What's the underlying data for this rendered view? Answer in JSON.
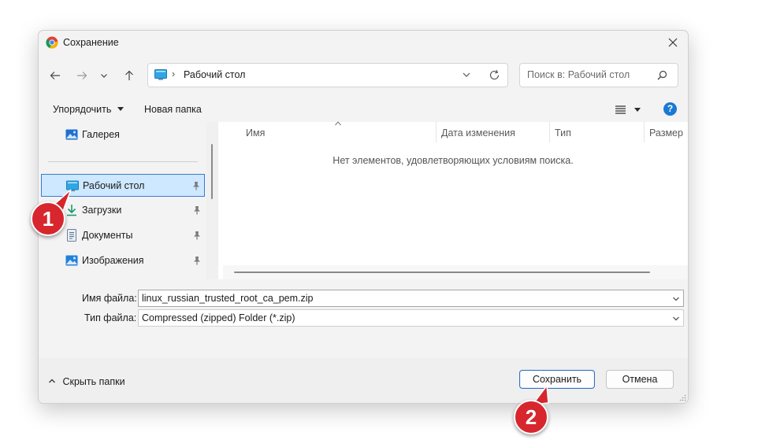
{
  "window": {
    "title": "Сохранение"
  },
  "address": {
    "path_label": "Рабочий стол",
    "separator": "›"
  },
  "search": {
    "placeholder": "Поиск в: Рабочий стол"
  },
  "toolbar": {
    "organize_label": "Упорядочить",
    "new_folder_label": "Новая папка",
    "help_label": "?"
  },
  "sidebar": {
    "items": [
      {
        "label": "Галерея",
        "icon": "gallery-icon",
        "pinned": false
      },
      {
        "label": "Рабочий стол",
        "icon": "desktop-icon",
        "pinned": true,
        "selected": true
      },
      {
        "label": "Загрузки",
        "icon": "download-icon",
        "pinned": true
      },
      {
        "label": "Документы",
        "icon": "documents-icon",
        "pinned": true
      },
      {
        "label": "Изображения",
        "icon": "pictures-icon",
        "pinned": true
      }
    ]
  },
  "filelist": {
    "columns": [
      "Имя",
      "Дата изменения",
      "Тип",
      "Размер"
    ],
    "empty_message": "Нет элементов, удовлетворяющих условиям поиска."
  },
  "form": {
    "filename_label": "Имя файла:",
    "filename_value": "linux_russian_trusted_root_ca_pem.zip",
    "filetype_label": "Тип файла:",
    "filetype_value": "Compressed (zipped) Folder (*.zip)"
  },
  "footer": {
    "hide_folders_label": "Скрыть папки",
    "save_label": "Сохранить",
    "cancel_label": "Отмена"
  },
  "annotations": {
    "step1": "1",
    "step2": "2"
  },
  "colors": {
    "accent": "#3b7bd4",
    "selection": "#cde8ff",
    "badge": "#d7262d"
  }
}
